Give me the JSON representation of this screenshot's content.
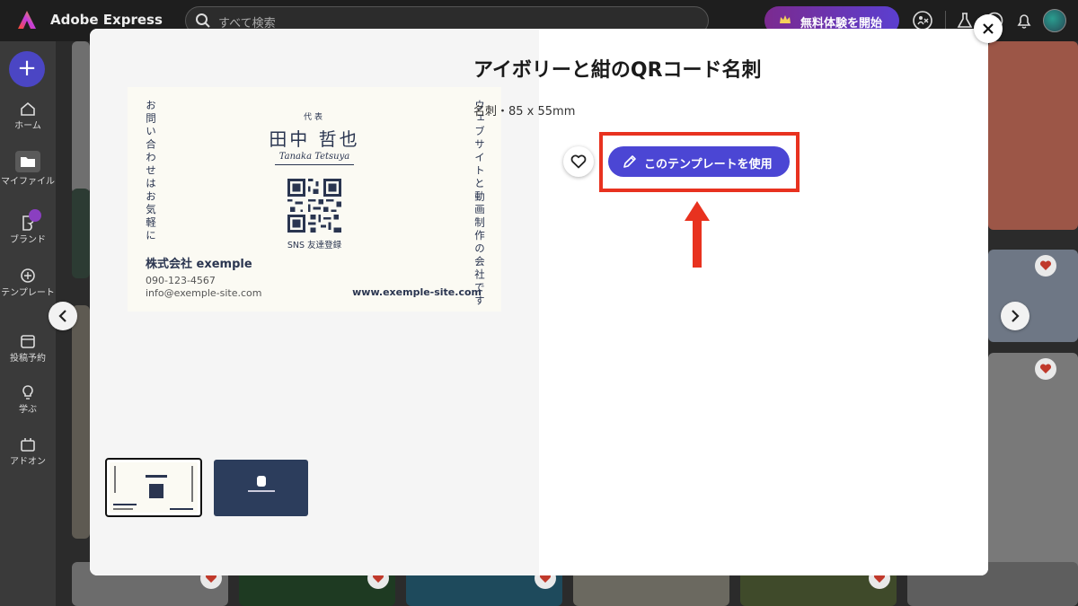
{
  "app": {
    "title": "Adobe Express"
  },
  "search": {
    "placeholder": "すべて検索"
  },
  "header": {
    "trial_label": "無料体験を開始"
  },
  "sidebar": {
    "create_label": "+",
    "items": [
      {
        "label": "ホーム",
        "icon": "home-icon"
      },
      {
        "label": "マイファイル",
        "icon": "folder-icon"
      },
      {
        "label": "ブランド",
        "icon": "brand-icon"
      },
      {
        "label": "テンプレート",
        "icon": "template-icon"
      },
      {
        "label": "投稿予約",
        "icon": "calendar-icon"
      },
      {
        "label": "学ぶ",
        "icon": "lightbulb-icon"
      },
      {
        "label": "アドオン",
        "icon": "addon-icon"
      }
    ]
  },
  "modal": {
    "title": "アイボリーと紺のQRコード名刺",
    "meta": "名刺・85 x 55mm",
    "use_button": "このテンプレートを使用"
  },
  "card": {
    "left_vertical": "お問い合わせはお気軽に",
    "right_vertical": "ウェブサイトと動画制作の会社です",
    "title": "代表",
    "name": "田中 哲也",
    "name_roman": "Tanaka Tetsuya",
    "sns": "SNS 友達登録",
    "company": "株式会社 exemple",
    "phone": "090-123-4567",
    "email": "info@exemple-site.com",
    "website": "www.exemple-site.com"
  },
  "colors": {
    "accent": "#4b46d4",
    "highlight": "#e8321f",
    "card_ink": "#2a3550",
    "card_bg": "#fbfaf3",
    "thumb_navy": "#2c3d5c"
  }
}
